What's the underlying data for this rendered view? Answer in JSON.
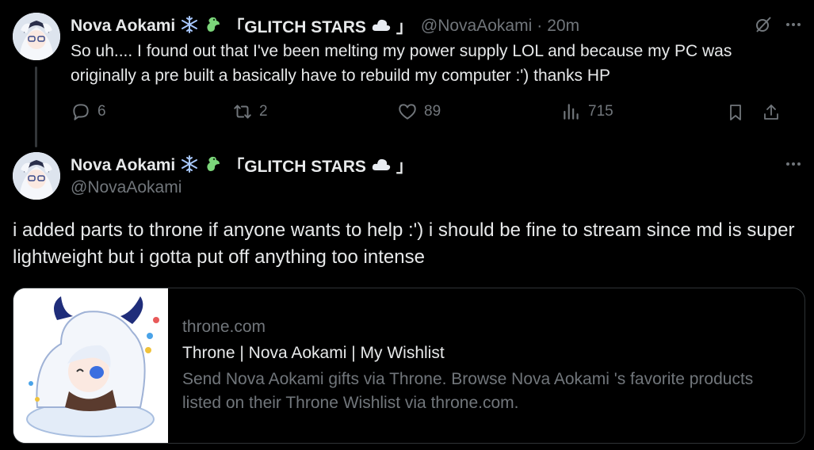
{
  "tweet1": {
    "display_name": "Nova Aokami",
    "name_suffix": "「GLITCH STARS",
    "name_close": "」",
    "handle": "@NovaAokami",
    "separator": "·",
    "timestamp": "20m",
    "text": "So uh.... I found out that I've been melting my power supply LOL and because my PC was originally a pre built a basically have to rebuild my computer :') thanks HP",
    "replies": "6",
    "retweets": "2",
    "likes": "89",
    "views": "715"
  },
  "tweet2": {
    "display_name": "Nova Aokami",
    "name_suffix": "「GLITCH STARS",
    "name_close": "」",
    "handle": "@NovaAokami",
    "text": "i added parts to throne if anyone wants to help :') i should be fine to stream since md is super lightweight but i gotta put off anything too intense",
    "card": {
      "domain": "throne.com",
      "title": "Throne | Nova Aokami | My Wishlist",
      "description": "Send Nova Aokami gifts via Throne. Browse Nova Aokami 's favorite products listed on their Throne Wishlist via throne.com."
    }
  },
  "colors": {
    "background": "#000000",
    "text_primary": "#e7e9ea",
    "text_secondary": "#71767b",
    "border": "#2f3336",
    "snowflake": "#a8c8ff",
    "dragon": "#7bd67a"
  },
  "icons": [
    "snowflake-icon",
    "dragon-icon",
    "cloud-icon",
    "grok-icon",
    "more-icon",
    "reply-icon",
    "retweet-icon",
    "like-icon",
    "views-icon",
    "bookmark-icon",
    "share-icon"
  ]
}
